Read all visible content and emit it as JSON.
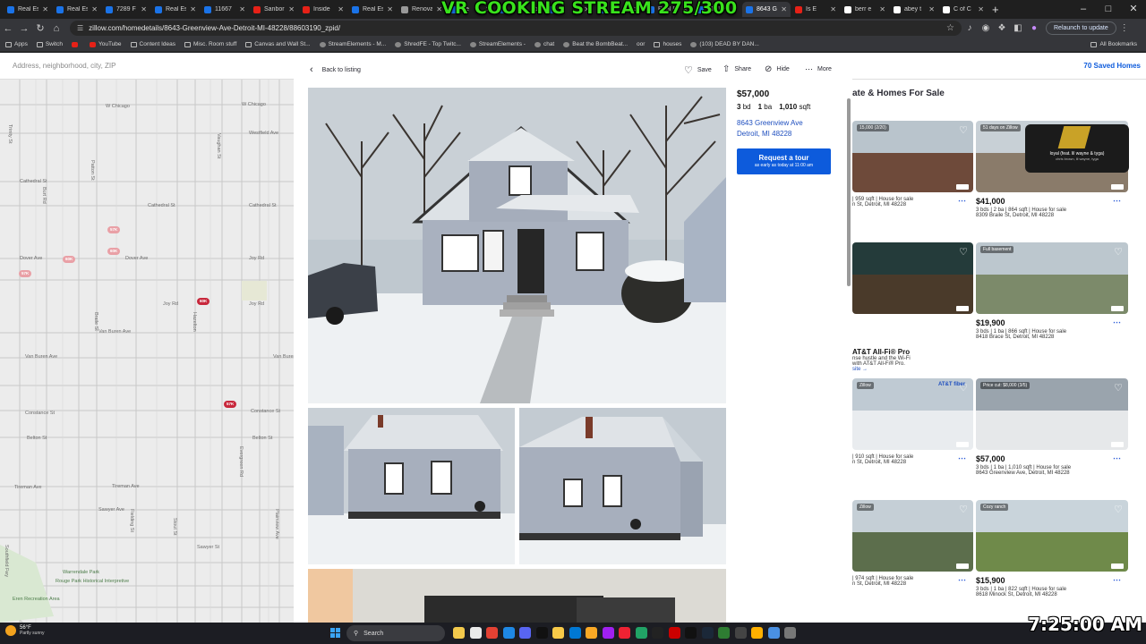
{
  "browser": {
    "tabs": [
      {
        "title": "Real Est",
        "color": "#1a73e8"
      },
      {
        "title": "Real Est",
        "color": "#1a73e8"
      },
      {
        "title": "7289 F",
        "color": "#1a73e8"
      },
      {
        "title": "Real Est",
        "color": "#1a73e8"
      },
      {
        "title": "11667",
        "color": "#1a73e8"
      },
      {
        "title": "Sanbor",
        "color": "#e62117"
      },
      {
        "title": "Inside",
        "color": "#e62117"
      },
      {
        "title": "Real Est",
        "color": "#1a73e8"
      },
      {
        "title": "Renova",
        "color": "#999999"
      },
      {
        "title": "Re",
        "color": "#1a73e8"
      },
      {
        "title": "",
        "color": "#1a73e8"
      },
      {
        "title": "",
        "color": "#1a73e8"
      },
      {
        "title": "",
        "color": "#1a73e8"
      },
      {
        "title": "Real Es",
        "color": "#1a73e8"
      },
      {
        "title": "8121 H",
        "color": "#1a73e8"
      },
      {
        "title": "8643 G",
        "color": "#1a73e8",
        "active": true
      },
      {
        "title": "Is E",
        "color": "#e62117"
      },
      {
        "title": "berr e",
        "color": "#ffffff"
      },
      {
        "title": "abey t",
        "color": "#ffffff"
      },
      {
        "title": "C of C",
        "color": "#ffffff"
      }
    ],
    "new_tab": "+",
    "url": "zillow.com/homedetails/8643-Greenview-Ave-Detroit-MI-48228/88603190_zpid/",
    "relaunch": "Relaunch to update",
    "bookmarks": [
      {
        "label": "Apps",
        "icon": "grid-icon"
      },
      {
        "label": "Switch",
        "icon": "folder-icon"
      },
      {
        "label": "",
        "icon": "youtube-icon"
      },
      {
        "label": "YouTube",
        "icon": "youtube-icon"
      },
      {
        "label": "Content Ideas",
        "icon": "folder-icon"
      },
      {
        "label": "Misc. Room stuff",
        "icon": "folder-icon"
      },
      {
        "label": "Canvas and Wall St...",
        "icon": "folder-icon"
      },
      {
        "label": "StreamElements - M...",
        "icon": "site-icon"
      },
      {
        "label": "ShredFE - Top Twitc...",
        "icon": "site-icon"
      },
      {
        "label": "StreamElements -",
        "icon": "site-icon"
      },
      {
        "label": "chat",
        "icon": "site-icon"
      },
      {
        "label": "Beat the BombBeat...",
        "icon": "site-icon"
      },
      {
        "label": "oor",
        "icon": "none"
      },
      {
        "label": "houses",
        "icon": "folder-icon"
      },
      {
        "label": "(103) DEAD BY DAN...",
        "icon": "site-icon"
      }
    ],
    "all_bookmarks": "All Bookmarks"
  },
  "overlay": {
    "text": "VR COOKING STREAM 275/300"
  },
  "zillow": {
    "search_placeholder": "Address, neighborhood, city, ZIP",
    "saved_homes": "70 Saved Homes",
    "results_header": "ate & Homes For Sale",
    "map": {
      "streets_h": [
        {
          "name": "W Chicago"
        },
        {
          "name": "W Chicago"
        },
        {
          "name": "Westfield Ave"
        },
        {
          "name": "Cathedral St"
        },
        {
          "name": "Cathedral St"
        },
        {
          "name": "Cathedral St"
        },
        {
          "name": "Dover Ave"
        },
        {
          "name": "Dover Ave"
        },
        {
          "name": "Joy Rd"
        },
        {
          "name": "Joy Rd"
        },
        {
          "name": "Joy Rd"
        },
        {
          "name": "Van Buren Ave"
        },
        {
          "name": "Van Buren Ave"
        },
        {
          "name": "Van Buren Ave"
        },
        {
          "name": "Constance St"
        },
        {
          "name": "Constance St"
        },
        {
          "name": "Belton St"
        },
        {
          "name": "Belton St"
        },
        {
          "name": "Tireman Ave"
        },
        {
          "name": "Tireman Ave"
        },
        {
          "name": "Sawyer Ave"
        },
        {
          "name": "Sawyer St"
        }
      ],
      "streets_v": [
        {
          "name": "Trinity St"
        },
        {
          "name": "Burt Rd"
        },
        {
          "name": "Patton St"
        },
        {
          "name": "Braile St"
        },
        {
          "name": "Fielding St"
        },
        {
          "name": "Stout St"
        },
        {
          "name": "Hazelton"
        },
        {
          "name": "Vaughan St"
        },
        {
          "name": "Evergreen Rd"
        },
        {
          "name": "Plainview Ave"
        },
        {
          "name": "Southfield Fwy"
        }
      ],
      "pins": [
        "60K",
        "60K",
        "57K",
        "57K",
        "60K",
        "57K"
      ],
      "poi": "Warrendale Park",
      "poi2": "Rouge Park Historical Interpretive",
      "poi3": "Eren Recreation Area"
    },
    "listing": {
      "back": "Back to listing",
      "save": "Save",
      "share": "Share",
      "hide": "Hide",
      "more": "More",
      "price": "$57,000",
      "beds": "3",
      "beds_label": "bd",
      "baths": "1",
      "baths_label": "ba",
      "sqft": "1,010",
      "sqft_label": "sqft",
      "address_line1": "8643 Greenview Ave",
      "address_line2": "Detroit, MI 48228",
      "tour_title": "Request a tour",
      "tour_subtitle": "as early as today at 11:00 am"
    },
    "cards": [
      {
        "tag": "15,000 (2/20)",
        "price": "",
        "facts": "| 959 sqft | House for sale",
        "addr": "n St, Detroit, MI 48228",
        "broker": "",
        "img": "#6e4a3a",
        "sky": "#b9c4cc"
      },
      {
        "tag": "51 days on Zillow",
        "price": "$41,000",
        "facts": "3 bds | 2 ba | 864 sqft | House for sale",
        "addr": "8309 Braile St, Detroit, MI 48228",
        "broker": "",
        "img": "#8a7b6a",
        "sky": "#c8d0d6"
      },
      {
        "tag": "",
        "price": "",
        "facts": "",
        "addr": "",
        "broker": "",
        "img": "#4a3a2a",
        "sky": "#243b3a"
      },
      {
        "tag": "Full basement",
        "price": "$19,900",
        "facts": "3 bds | 1 ba | 866 sqft | House for sale",
        "addr": "8418 Brace St, Detroit, MI 48228",
        "broker": "",
        "img": "#7c8a6a",
        "sky": "#bcc7ce"
      },
      {
        "tag": "Zillow",
        "price": "",
        "facts": "| 910 sqft | House for sale",
        "addr": "n St, Detroit, MI 48228",
        "broker": "",
        "img": "#e9ecef",
        "sky": "#bfcad3"
      },
      {
        "tag": "Price cut: $8,000 (3/5)",
        "price": "$57,000",
        "facts": "3 bds | 1 ba | 1,010 sqft | House for sale",
        "addr": "8643 Greenview Ave, Detroit, MI 48228",
        "broker": "",
        "img": "#e6e8ea",
        "sky": "#9aa4ad"
      },
      {
        "tag": "Zillow",
        "price": "",
        "facts": "| 974 sqft | House for sale",
        "addr": "n St, Detroit, MI 48228",
        "broker": "",
        "img": "#5c6e4c",
        "sky": "#c5cfd6"
      },
      {
        "tag": "Cozy ranch",
        "price": "$15,900",
        "facts": "3 bds | 1 ba | 822 sqft | House for sale",
        "addr": "8618 Minock St, Detroit, MI 48228",
        "broker": "",
        "img": "#6f8a4a",
        "sky": "#c9d4db"
      }
    ],
    "ad": {
      "title": "AT&T All-Fi® Pro",
      "body": "nse hustle and the Wi-Fi",
      "body2": "with AT&T All-Fi® Pro.",
      "link": "site →",
      "brand": "AT&T fiber"
    },
    "music_widget": {
      "title": "loyal (feat. lil wayne & tyga)",
      "artist": "chris brown, lil wayne, tyga"
    }
  },
  "taskbar": {
    "temp": "56°F",
    "condition": "Partly sunny",
    "search": "Search",
    "clock": "7:25:00 AM"
  }
}
